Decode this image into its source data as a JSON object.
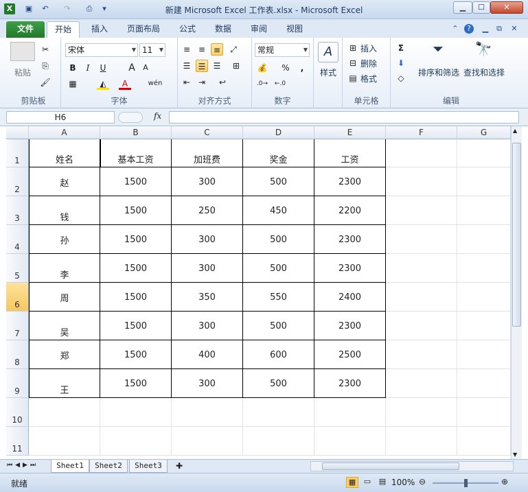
{
  "window": {
    "title": "新建 Microsoft Excel 工作表.xlsx - Microsoft Excel"
  },
  "tabs": [
    "文件",
    "开始",
    "插入",
    "页面布局",
    "公式",
    "数据",
    "审阅",
    "视图"
  ],
  "ribbon": {
    "clipboard": {
      "label": "剪贴板",
      "paste": "粘贴"
    },
    "font": {
      "label": "字体",
      "name": "宋体",
      "size": "11",
      "bold": "B",
      "italic": "I",
      "underline": "U",
      "grow": "A",
      "shrink": "A",
      "fontcolor": "A",
      "wen": "wén"
    },
    "align": {
      "label": "对齐方式"
    },
    "number": {
      "label": "数字",
      "format": "常规",
      "percent": "%",
      "comma": ","
    },
    "styles": {
      "label": "样式"
    },
    "cells": {
      "label": "单元格",
      "insert": "插入",
      "delete": "删除",
      "format": "格式"
    },
    "editing": {
      "label": "编辑",
      "sum": "Σ",
      "sort": "排序和筛选",
      "find": "查找和选择"
    }
  },
  "formula_bar": {
    "name_box": "H6",
    "fx": "fx",
    "value": ""
  },
  "columns": [
    "A",
    "B",
    "C",
    "D",
    "E",
    "F",
    "G"
  ],
  "rows": [
    "1",
    "2",
    "3",
    "4",
    "5",
    "6",
    "7",
    "8",
    "9",
    "10",
    "11"
  ],
  "selected_row": "6",
  "table": {
    "header": [
      "姓名",
      "基本工资",
      "加班费",
      "奖金",
      "工资"
    ],
    "data": [
      [
        "赵",
        "1500",
        "300",
        "500",
        "2300"
      ],
      [
        "钱",
        "1500",
        "250",
        "450",
        "2200"
      ],
      [
        "孙",
        "1500",
        "300",
        "500",
        "2300"
      ],
      [
        "李",
        "1500",
        "300",
        "500",
        "2300"
      ],
      [
        "周",
        "1500",
        "350",
        "550",
        "2400"
      ],
      [
        "吴",
        "1500",
        "300",
        "500",
        "2300"
      ],
      [
        "郑",
        "1500",
        "400",
        "600",
        "2500"
      ],
      [
        "王",
        "1500",
        "300",
        "500",
        "2300"
      ]
    ]
  },
  "sheets": [
    "Sheet1",
    "Sheet2",
    "Sheet3"
  ],
  "active_sheet": "Sheet1",
  "status": {
    "ready": "就绪",
    "zoom": "100%"
  },
  "colors": {
    "file_tab": "#2a8a34",
    "selection": "#f6c760",
    "ribbon_bg": "#dfe9f5"
  }
}
